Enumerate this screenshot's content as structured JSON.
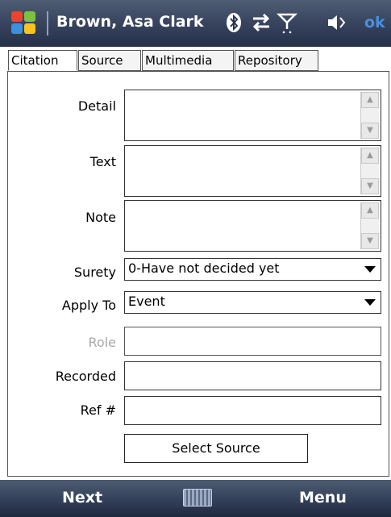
{
  "title_bar": {
    "title": "Brown, Asa Clark",
    "ok_label": "ok",
    "icons": [
      "windows-start-icon",
      "bluetooth-icon",
      "connectivity-icon",
      "signal-icon",
      "speaker-icon"
    ]
  },
  "tabs": [
    {
      "label": "Citation",
      "active": true
    },
    {
      "label": "Source",
      "active": false
    },
    {
      "label": "Multimedia",
      "active": false
    },
    {
      "label": "Repository",
      "active": false
    }
  ],
  "form": {
    "detail_label": "Detail",
    "text_label": "Text",
    "note_label": "Note",
    "surety_label": "Surety",
    "surety_value": "0-Have not decided yet",
    "apply_to_label": "Apply To",
    "apply_to_value": "Event",
    "role_label": "Role",
    "recorded_label": "Recorded",
    "ref_label": "Ref #",
    "select_source_label": "Select Source"
  },
  "softkeys": {
    "left": "Next",
    "right": "Menu"
  },
  "colors": {
    "title_bar": "#3a4660",
    "ok": "#4a8fe0",
    "disabled_label": "#a8a8a8"
  }
}
